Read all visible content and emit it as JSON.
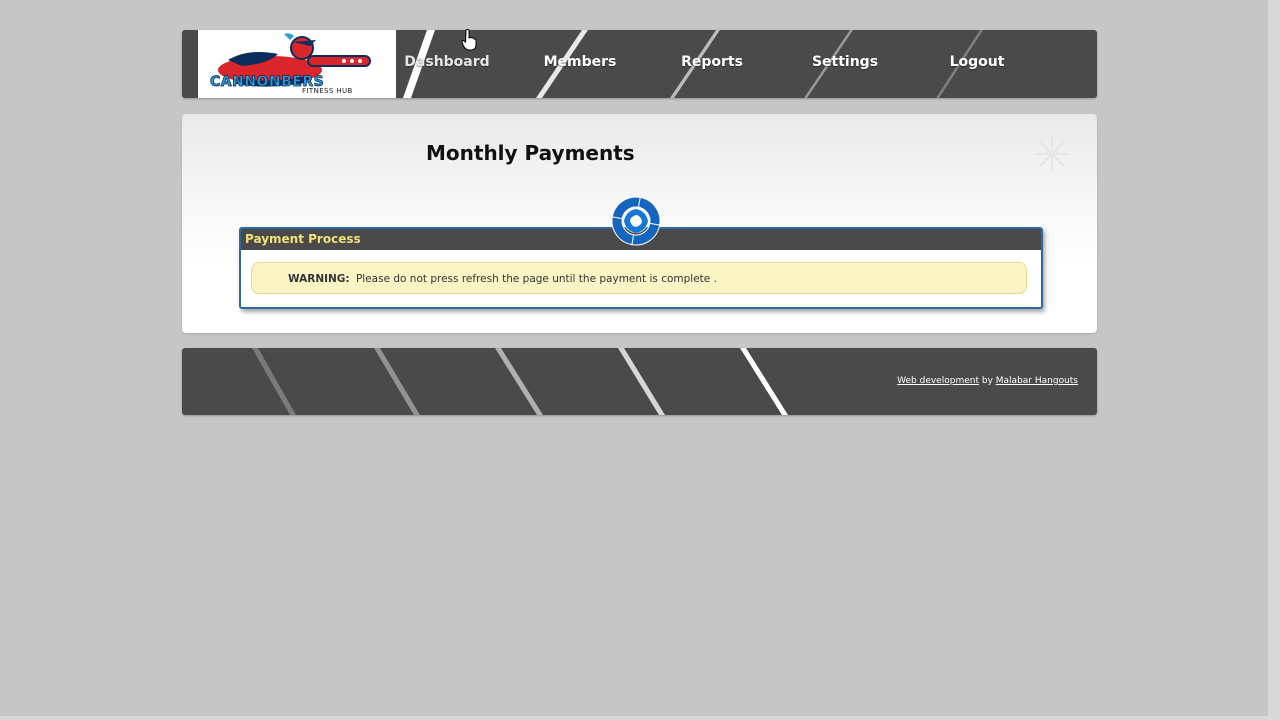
{
  "logo": {
    "brand": "CANNONBERS",
    "subtitle": "FITNESS HUB"
  },
  "nav": {
    "items": [
      {
        "label": "Dashboard",
        "active": true
      },
      {
        "label": "Members"
      },
      {
        "label": "Reports"
      },
      {
        "label": "Settings"
      },
      {
        "label": "Logout"
      }
    ]
  },
  "content": {
    "title": "Monthly Payments",
    "payment_box": {
      "header": "Payment Process",
      "warning_label": "WARNING:",
      "warning_text": "Please do not press refresh the page until the payment is complete ."
    }
  },
  "footer": {
    "link1": "Web development",
    "by": "by",
    "link2": "Malabar Hangouts"
  },
  "colors": {
    "bar": "#4a4a4a",
    "page_bg": "#c6c6c6",
    "box_border": "#2c6aa0",
    "box_header_text": "#f2e07a",
    "warning_bg": "#fbf5c5",
    "spinner": "#1565c0"
  },
  "icons": {
    "spinner": "loading-spinner-icon",
    "sparkle": "sparkle-icon",
    "cursor": "hand-cursor-icon"
  }
}
